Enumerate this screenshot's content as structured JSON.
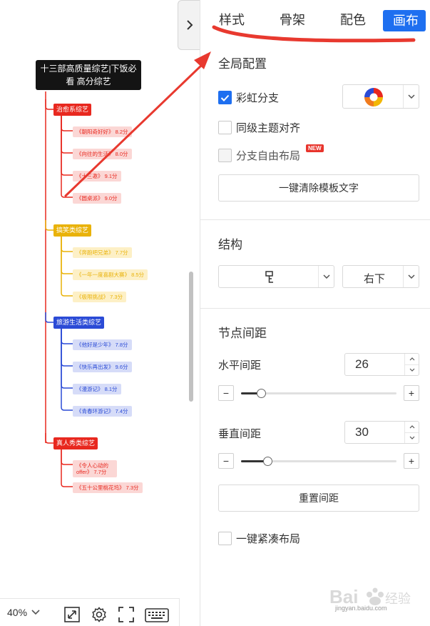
{
  "canvas": {
    "mindmap": {
      "root": "十三部高质量综艺|下饭必看 高分综艺",
      "categories": [
        {
          "label": "治愈系综艺",
          "color": "#e8281f",
          "leaf_bg": "#fbd7d5",
          "items": [
            "《朝阳奇好好》 8.2分",
            "《向往的生活》 8.0分",
            "《十三邀》 9.1分",
            "《圆桌派》 9.0分"
          ]
        },
        {
          "label": "搞笑类综艺",
          "color": "#e9b209",
          "leaf_bg": "#fdf0c6",
          "items": [
            "《奔跑吧兄弟》 7.7分",
            "《一年一度喜剧大赛》 8.5分",
            "《极限挑战》 7.3分"
          ]
        },
        {
          "label": "旅游生活类综艺",
          "color": "#2b4bd6",
          "leaf_bg": "#d6dcf8",
          "items": [
            "《他好是少年》 7.8分",
            "《快乐再出发》 9.6分",
            "《漫游记》 8.1分",
            "《青春环游记》 7.4分"
          ]
        },
        {
          "label": "真人秀类综艺",
          "color": "#e8281f",
          "leaf_bg": "#fbd7d5",
          "items": [
            "《令人心动的offer》 7.7分",
            "《五十公里桃花坞》 7.3分"
          ]
        }
      ]
    }
  },
  "toolbar": {
    "zoom_label": "40%"
  },
  "panel": {
    "tabs": [
      {
        "label": "样式"
      },
      {
        "label": "骨架"
      },
      {
        "label": "配色"
      },
      {
        "label": "画布"
      }
    ],
    "global": {
      "title": "全局配置",
      "rainbow_label": "彩虹分支",
      "align_label": "同级主题对齐",
      "free_layout_label": "分支自由布局",
      "new_badge": "NEW",
      "clear_button": "一键清除模板文字"
    },
    "structure": {
      "title": "结构",
      "direction_value": "右下"
    },
    "spacing": {
      "title": "节点间距",
      "horizontal_label": "水平间距",
      "horizontal_value": "26",
      "horizontal_level": 0.13,
      "vertical_label": "垂直间距",
      "vertical_value": "30",
      "vertical_level": 0.17,
      "minus": "−",
      "plus": "+",
      "reset_button": "重置间距",
      "compact_label": "一键紧凑布局"
    }
  },
  "watermark": {
    "logo_text": "Baidu 经验",
    "url": "jingyan.baidu.com"
  },
  "colors": {
    "accent": "#1e6ff0",
    "annotation_red": "#e8392f"
  }
}
